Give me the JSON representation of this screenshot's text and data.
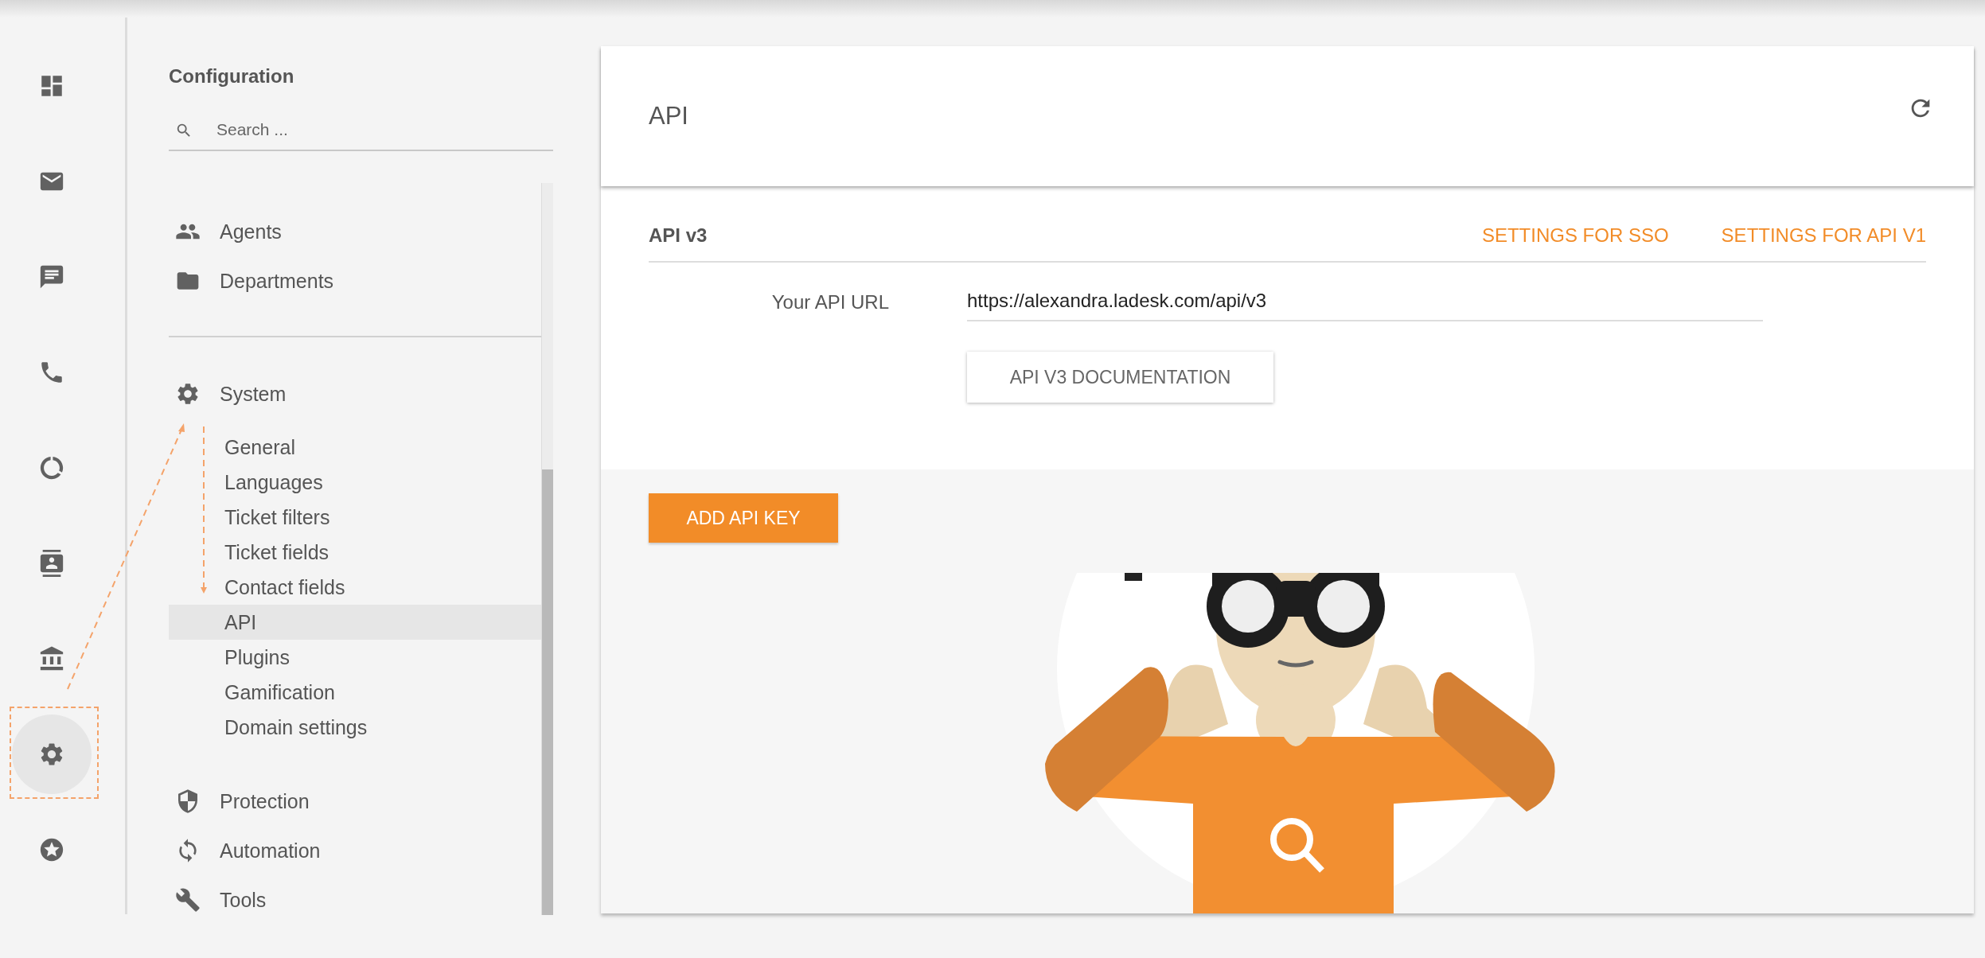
{
  "rail": {
    "items": [
      {
        "selected": false
      },
      {
        "selected": false
      },
      {
        "selected": false
      },
      {
        "selected": false
      },
      {
        "selected": false
      },
      {
        "selected": false
      },
      {
        "selected": false
      },
      {
        "selected": true
      },
      {
        "selected": false
      }
    ]
  },
  "sidebar": {
    "title": "Configuration",
    "search": {
      "placeholder": "Search ..."
    },
    "groups": [
      {
        "items": [
          {
            "label": "Agents",
            "selected": false
          },
          {
            "label": "Departments",
            "selected": false
          }
        ]
      },
      {
        "items": [
          {
            "label": "System",
            "selected": false,
            "children": [
              {
                "label": "General",
                "selected": false
              },
              {
                "label": "Languages",
                "selected": false
              },
              {
                "label": "Ticket filters",
                "selected": false
              },
              {
                "label": "Ticket fields",
                "selected": false
              },
              {
                "label": "Contact fields",
                "selected": false
              },
              {
                "label": "API",
                "selected": true
              },
              {
                "label": "Plugins",
                "selected": false
              },
              {
                "label": "Gamification",
                "selected": false
              },
              {
                "label": "Domain settings",
                "selected": false
              }
            ]
          },
          {
            "label": "Protection",
            "selected": false
          },
          {
            "label": "Automation",
            "selected": false
          },
          {
            "label": "Tools",
            "selected": false
          }
        ]
      }
    ]
  },
  "main": {
    "title": "API",
    "section": {
      "title": "API v3",
      "links": [
        "SETTINGS FOR SSO",
        "SETTINGS FOR API V1"
      ],
      "field": {
        "label": "Your API URL",
        "value": "https://alexandra.ladesk.com/api/v3"
      },
      "doc_button": "API V3 DOCUMENTATION"
    },
    "add_button": "ADD API KEY"
  }
}
